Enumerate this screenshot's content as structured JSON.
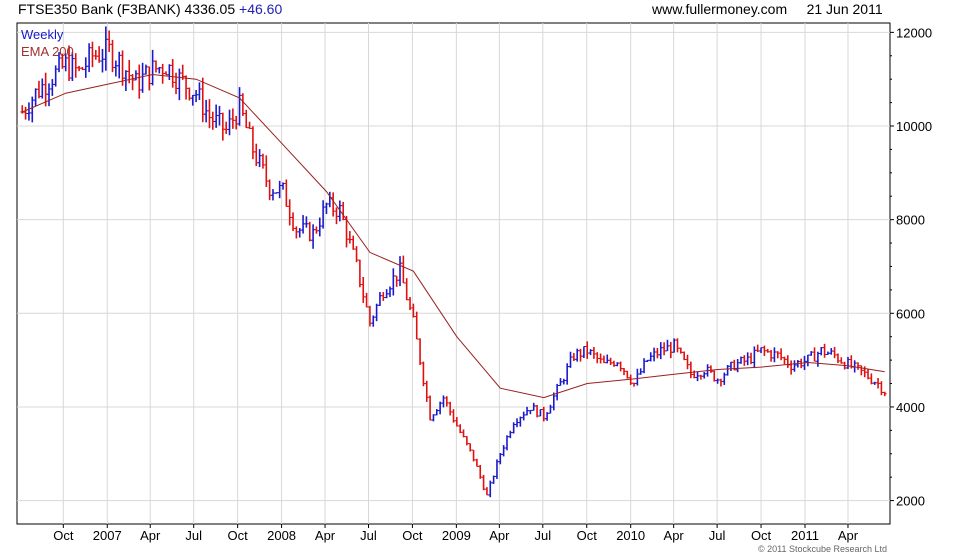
{
  "header": {
    "instrument": "FTSE350 Bank (F3BANK)",
    "last": "4336.05",
    "change": "+46.60",
    "site": "www.fullermoney.com",
    "date": "21 Jun 2011"
  },
  "legend": {
    "weekly": "Weekly",
    "ema": "EMA 200"
  },
  "copyright": "© 2011 Stockcube Research Ltd",
  "colors": {
    "up": "#1a1acc",
    "down": "#e01010",
    "ema": "#9a2020",
    "grid": "#d8d8d8"
  },
  "chart_data": {
    "type": "line",
    "title": "FTSE350 Bank (F3BANK) 4336.05 +46.60",
    "ylim": [
      1500,
      12200
    ],
    "y_ticks": [
      2000,
      4000,
      6000,
      8000,
      10000,
      12000
    ],
    "x_ticks": [
      "Oct",
      "2007",
      "Apr",
      "Jul",
      "Oct",
      "2008",
      "Apr",
      "Jul",
      "Oct",
      "2009",
      "Apr",
      "Jul",
      "Oct",
      "2010",
      "Apr",
      "Jul",
      "Oct",
      "2011",
      "Apr"
    ],
    "grid": true,
    "legend_position": "top-left",
    "series": [
      {
        "name": "Weekly",
        "style": "ohlc-bars",
        "x": [
          "2006-07-07",
          "2006-08-04",
          "2006-09-01",
          "2006-10-06",
          "2006-11-03",
          "2006-12-01",
          "2007-01-05",
          "2007-02-02",
          "2007-03-02",
          "2007-04-06",
          "2007-05-04",
          "2007-06-01",
          "2007-07-06",
          "2007-08-03",
          "2007-09-07",
          "2007-10-05",
          "2007-11-02",
          "2007-12-07",
          "2008-01-04",
          "2008-02-01",
          "2008-03-07",
          "2008-04-04",
          "2008-05-02",
          "2008-06-06",
          "2008-07-04",
          "2008-08-01",
          "2008-09-05",
          "2008-10-03",
          "2008-11-07",
          "2008-12-05",
          "2009-01-02",
          "2009-02-06",
          "2009-03-06",
          "2009-04-03",
          "2009-05-01",
          "2009-06-05",
          "2009-07-03",
          "2009-08-07",
          "2009-09-04",
          "2009-10-02",
          "2009-11-06",
          "2009-12-04",
          "2010-01-08",
          "2010-02-05",
          "2010-03-05",
          "2010-04-02",
          "2010-05-07",
          "2010-06-04",
          "2010-07-02",
          "2010-08-06",
          "2010-09-03",
          "2010-10-01",
          "2010-11-05",
          "2010-12-03",
          "2011-01-07",
          "2011-02-04",
          "2011-03-04",
          "2011-04-01",
          "2011-05-06",
          "2011-06-03",
          "2011-06-17"
        ],
        "values": [
          10300,
          10700,
          11000,
          11300,
          11150,
          11500,
          11600,
          11300,
          10900,
          11200,
          11300,
          11000,
          10700,
          10200,
          9900,
          10400,
          9500,
          8700,
          8600,
          7800,
          7700,
          8300,
          8200,
          7000,
          5800,
          6500,
          6900,
          5800,
          3800,
          4200,
          3600,
          2900,
          2100,
          3000,
          3700,
          4000,
          3800,
          4500,
          5100,
          5200,
          4900,
          5000,
          4500,
          5000,
          5200,
          5300,
          4700,
          4800,
          4600,
          4900,
          5000,
          5200,
          5100,
          4900,
          5000,
          5200,
          5100,
          4900,
          4700,
          4500,
          4336
        ]
      },
      {
        "name": "EMA 200",
        "style": "line",
        "x": [
          "2006-07-07",
          "2006-10-06",
          "2007-01-05",
          "2007-04-06",
          "2007-07-06",
          "2007-10-05",
          "2008-01-04",
          "2008-04-04",
          "2008-07-04",
          "2008-10-03",
          "2009-01-02",
          "2009-04-03",
          "2009-07-03",
          "2009-10-02",
          "2010-01-08",
          "2010-04-02",
          "2010-07-02",
          "2010-10-01",
          "2011-01-07",
          "2011-04-01",
          "2011-06-17"
        ],
        "values": [
          10300,
          10700,
          10900,
          11100,
          11000,
          10600,
          9600,
          8600,
          7300,
          6900,
          5500,
          4400,
          4200,
          4500,
          4600,
          4700,
          4800,
          4850,
          4950,
          4880,
          4750
        ]
      }
    ]
  }
}
